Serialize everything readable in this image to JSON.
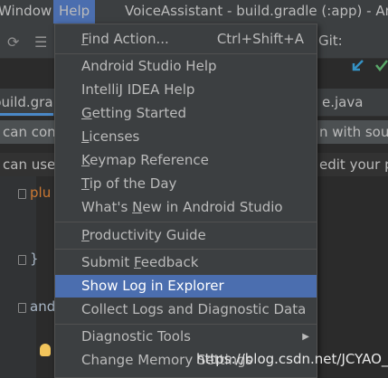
{
  "window_title": "VoiceAssistant - build.gradle (:app) - And",
  "menubar": {
    "window_label": "Window",
    "help_label": "Help"
  },
  "toolbar": {
    "git_label": "Git:"
  },
  "tabs": {
    "gradle_tab": "build.gra",
    "java_tab": "e.java"
  },
  "banners": {
    "line1_left": "can con",
    "line1_right": "n with sour",
    "line2_left": "can use",
    "line2_right": "edit your p"
  },
  "editor": {
    "line_plugins": "plu",
    "line_close": "}",
    "line_android": "and"
  },
  "help_menu": {
    "items": [
      {
        "label_pre": "",
        "label_ul": "F",
        "label_post": "ind Action...",
        "shortcut": "Ctrl+Shift+A"
      },
      {
        "label": "Android Studio Help"
      },
      {
        "label": "IntelliJ IDEA Help"
      },
      {
        "label_pre": "",
        "label_ul": "G",
        "label_post": "etting Started"
      },
      {
        "label_pre": "",
        "label_ul": "L",
        "label_post": "icenses"
      },
      {
        "label_pre": "",
        "label_ul": "K",
        "label_post": "eymap Reference"
      },
      {
        "label_pre": "",
        "label_ul": "T",
        "label_post": "ip of the Day"
      },
      {
        "label_pre": "What's ",
        "label_ul": "N",
        "label_post": "ew in Android Studio"
      },
      {
        "label_pre": "",
        "label_ul": "P",
        "label_post": "roductivity Guide"
      },
      {
        "label_pre": "Submit ",
        "label_ul": "F",
        "label_post": "eedback"
      },
      {
        "label": "Show Log in Explorer",
        "selected": true
      },
      {
        "label": "Collect Logs and Diagnostic Data"
      },
      {
        "label": "Diagnostic Tools",
        "submenu": true
      },
      {
        "label": "Change Memory Settings"
      }
    ]
  },
  "watermark": "https://blog.csdn.net/JCYAO_",
  "colors": {
    "menu_bg": "#3c3f41",
    "selection": "#4b6eaf",
    "editor_bg": "#2b2b2b",
    "keyword": "#cc7832"
  }
}
